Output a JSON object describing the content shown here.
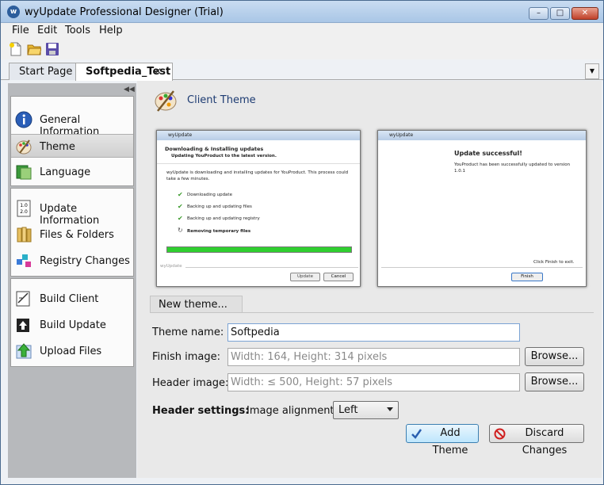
{
  "window": {
    "title": "wyUpdate Professional Designer (Trial)",
    "min_glyph": "–",
    "max_glyph": "□",
    "close_glyph": "✕",
    "app_icon_letter": "w"
  },
  "menu": [
    "File",
    "Edit",
    "Tools",
    "Help"
  ],
  "tabs": {
    "items": [
      "Start Page",
      "Softpedia_Test"
    ],
    "close_glyph": "✕",
    "dropdown_glyph": "▼"
  },
  "sidebar": {
    "collapse_glyph": "◀◀",
    "groups": [
      {
        "items": [
          {
            "label": "General Information",
            "icon": "info-icon"
          },
          {
            "label": "Theme",
            "icon": "palette-icon",
            "selected": true
          },
          {
            "label": "Language",
            "icon": "language-icon"
          }
        ]
      },
      {
        "items": [
          {
            "label": "Update Information",
            "icon": "version-icon"
          },
          {
            "label": "Files & Folders",
            "icon": "files-icon"
          },
          {
            "label": "Registry Changes",
            "icon": "registry-icon"
          }
        ]
      },
      {
        "items": [
          {
            "label": "Build Client",
            "icon": "build-client-icon"
          },
          {
            "label": "Build Update",
            "icon": "build-update-icon"
          },
          {
            "label": "Upload Files",
            "icon": "upload-icon"
          }
        ]
      }
    ]
  },
  "page": {
    "title": "Client Theme"
  },
  "preview_left": {
    "title": "wyUpdate",
    "heading": "Downloading & Installing updates",
    "subheading": "Updating YouProduct to the latest version.",
    "desc_line1": "wyUpdate is downloading and installing updates for YouProduct. This process could",
    "desc_line2": "take a few minutes.",
    "steps": [
      "Downloading update",
      "Backing up and updating files",
      "Backing up and updating registry",
      "Removing temporary files"
    ],
    "footer": "wyUpdate",
    "btn_update": "Update",
    "btn_cancel": "Cancel"
  },
  "preview_right": {
    "title": "wyUpdate",
    "heading": "Update successful!",
    "desc_line1": "YouProduct has been successfully updated to version",
    "desc_line2": "1.0.1",
    "finish_hint": "Click Finish to exit.",
    "btn_finish": "Finish"
  },
  "form": {
    "section_label": "New theme...",
    "theme_name_label": "Theme name:",
    "theme_name_value": "Softpedia",
    "finish_image_label": "Finish image:",
    "finish_image_placeholder": "Width: 164, Height: 314 pixels",
    "header_image_label": "Header image:",
    "header_image_placeholder": "Width: ≤ 500, Height: 57 pixels",
    "browse_label": "Browse...",
    "header_settings_label": "Header settings:",
    "image_alignment_label": "Image alignment:",
    "image_alignment_value": "Left",
    "add_theme_label": "Add Theme",
    "discard_label": "Discard Changes"
  },
  "colors": {
    "accent_title": "#1d3b72",
    "progress_green": "#2fcf2f",
    "sidebar_bg": "#b7b9bc"
  }
}
